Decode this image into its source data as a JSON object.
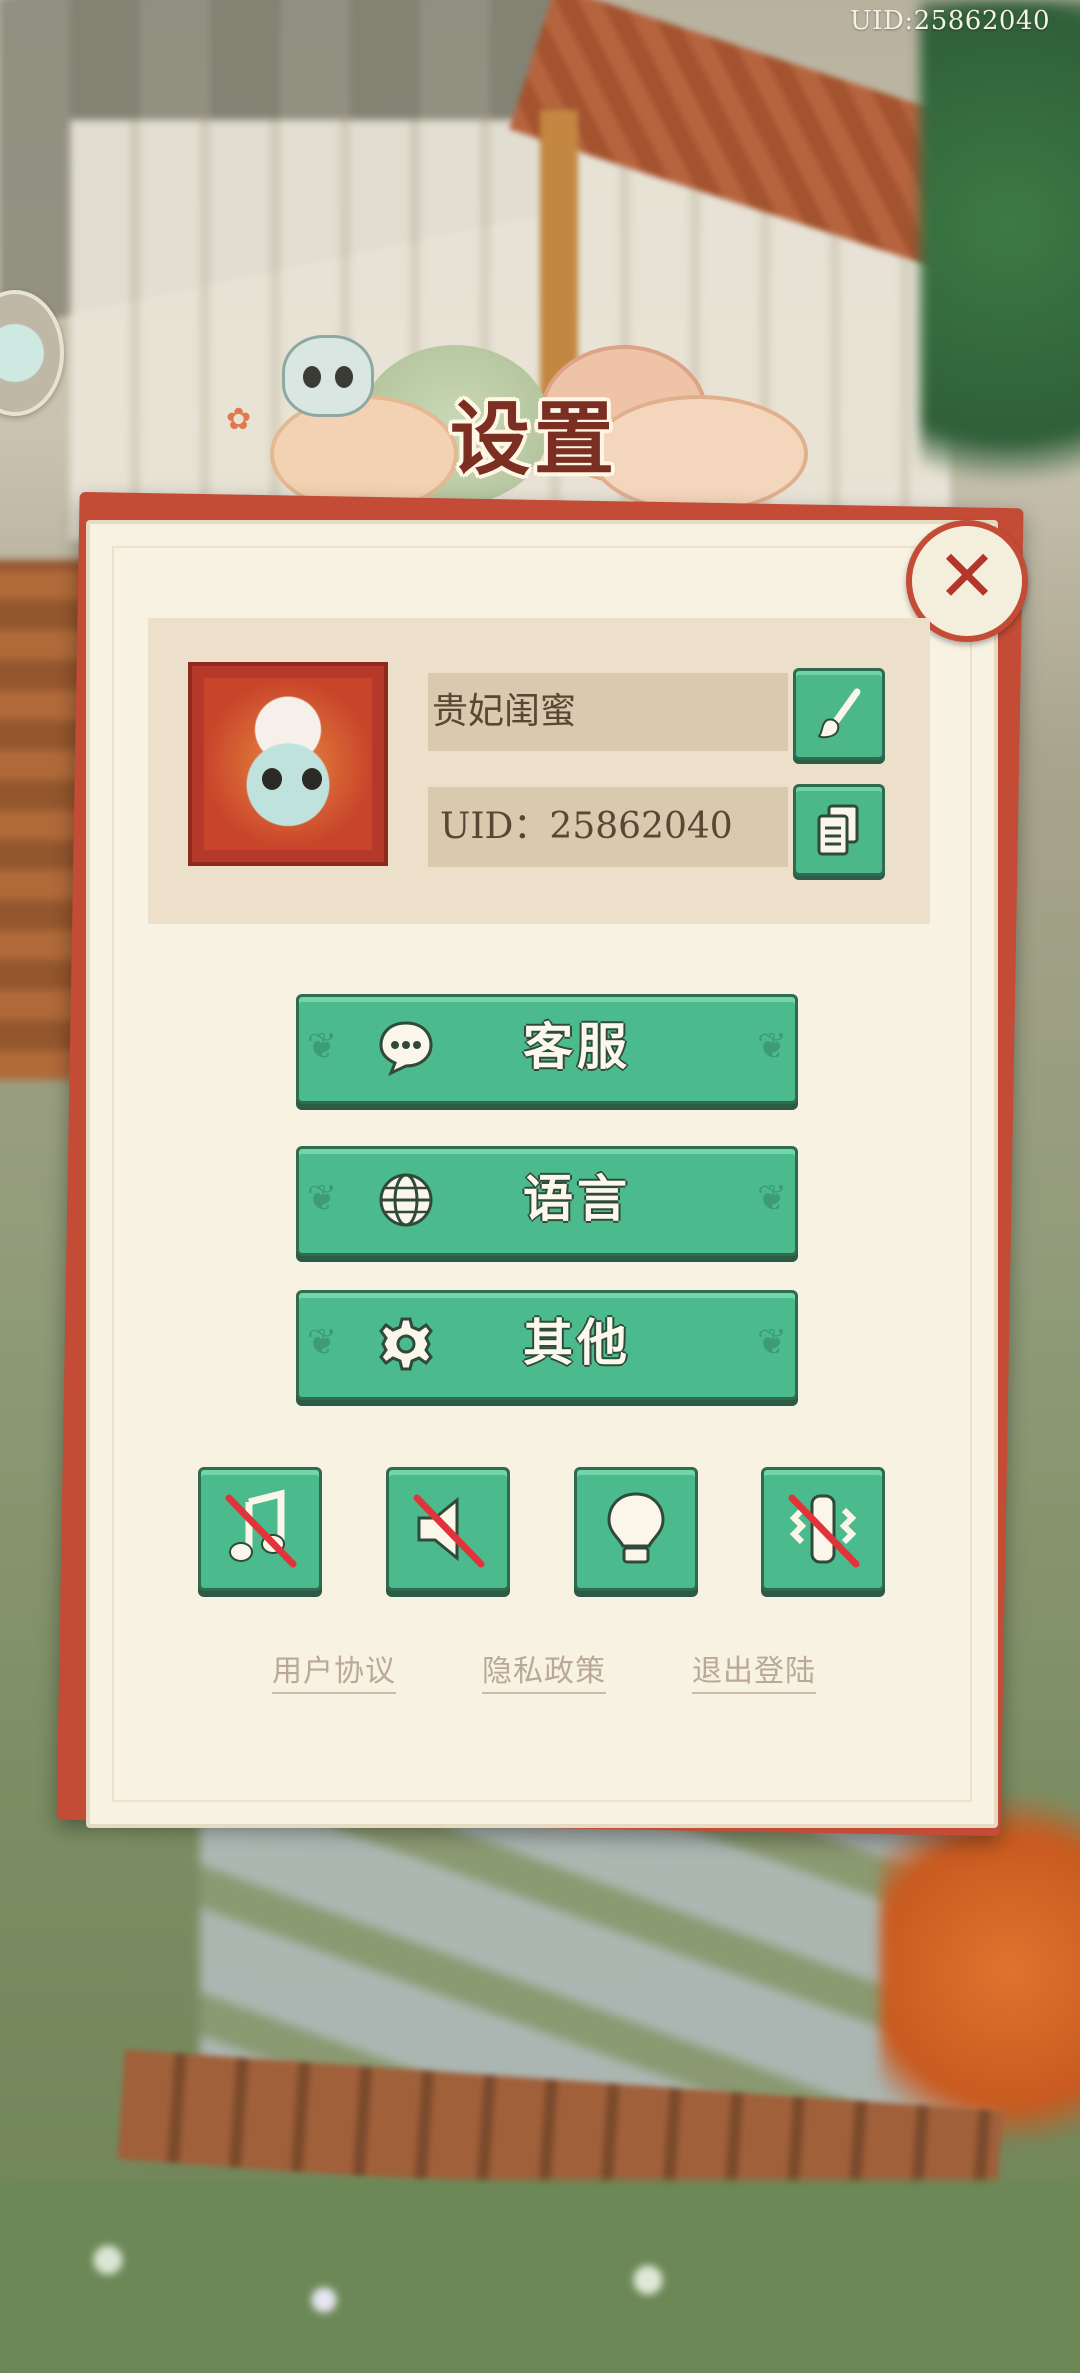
{
  "status": {
    "uid_text": "UID:25862040"
  },
  "dialog": {
    "title": "设置",
    "close_label": "✕"
  },
  "profile": {
    "name": "贵妃闺蜜",
    "uid_text": "UID：25862040"
  },
  "menu": [
    {
      "label": "客服",
      "icon": "chat-bubble-icon"
    },
    {
      "label": "语言",
      "icon": "globe-icon"
    },
    {
      "label": "其他",
      "icon": "gear-icon"
    }
  ],
  "toggles": [
    {
      "icon": "music-note-icon",
      "state": "off"
    },
    {
      "icon": "speaker-icon",
      "state": "off"
    },
    {
      "icon": "lightbulb-icon",
      "state": "on"
    },
    {
      "icon": "vibration-icon",
      "state": "off"
    }
  ],
  "links": {
    "user_agreement": "用户协议",
    "privacy_policy": "隐私政策",
    "logout": "退出登陆"
  },
  "colors": {
    "accent_green": "#4bba8c",
    "frame_red": "#c44b35",
    "paper": "#f8f2e2",
    "title_brown": "#7a2f22"
  }
}
